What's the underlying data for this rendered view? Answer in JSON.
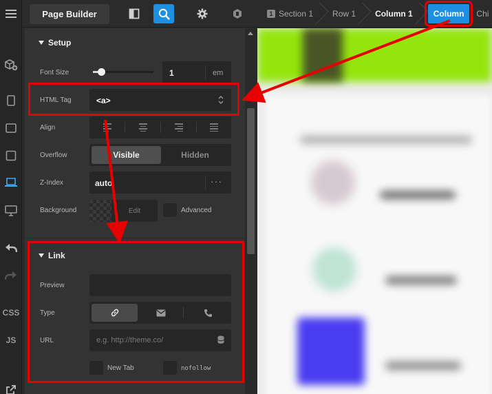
{
  "topbar": {
    "brand": "Page Builder",
    "buttons": [
      "layout-icon",
      "search-icon",
      "gear-icon",
      "theme-icon"
    ]
  },
  "rail": {
    "css_label": "CSS",
    "js_label": "JS"
  },
  "breadcrumbs": [
    {
      "num": "1",
      "label": "Section 1"
    },
    {
      "label": "Row 1"
    },
    {
      "label": "Column 1"
    },
    {
      "label": "Column"
    },
    {
      "label": "Chi"
    }
  ],
  "setup": {
    "title": "Setup",
    "font_size": {
      "label": "Font Size",
      "value": "1",
      "unit": "em",
      "slider_fraction": 0.1
    },
    "html_tag": {
      "label": "HTML Tag",
      "value": "<a>"
    },
    "align": {
      "label": "Align",
      "options": [
        "align-left-icon",
        "align-center-icon",
        "align-right-icon",
        "align-justify-icon"
      ]
    },
    "overflow": {
      "label": "Overflow",
      "options": [
        "Visible",
        "Hidden"
      ],
      "selected": "Visible"
    },
    "zindex": {
      "label": "Z-Index",
      "value": "auto",
      "more": "···"
    },
    "background": {
      "label": "Background",
      "edit": "Edit",
      "advanced": "Advanced"
    }
  },
  "link": {
    "title": "Link",
    "preview_label": "Preview",
    "type_label": "Type",
    "type_options": [
      "link-icon",
      "mail-icon",
      "phone-icon"
    ],
    "url_label": "URL",
    "url_placeholder": "e.g. http://theme.co/",
    "new_tab": "New Tab",
    "nofollow": "nofollow"
  },
  "colors": {
    "accent": "#1e8fe1",
    "annotation": "#e60000",
    "panel": "#333333",
    "preview_green": "#94e50d",
    "preview_purple": "#4a3cf0"
  }
}
